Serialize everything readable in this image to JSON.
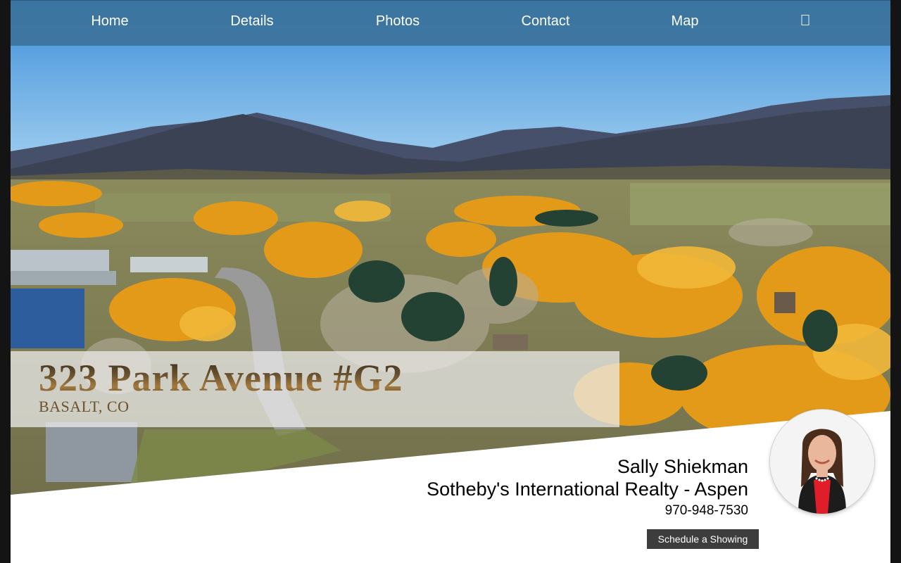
{
  "nav": {
    "items": [
      {
        "label": "Home"
      },
      {
        "label": "Details"
      },
      {
        "label": "Photos"
      },
      {
        "label": "Contact"
      },
      {
        "label": "Map"
      }
    ],
    "extra_icon": "square-icon"
  },
  "listing": {
    "address": "323 Park Avenue #G2",
    "city_state": "BASALT, CO"
  },
  "agent": {
    "name": "Sally Shiekman",
    "company": "Sotheby's International Realty - Aspen",
    "phone": "970-948-7530",
    "schedule_label": "Schedule a Showing"
  },
  "colors": {
    "nav_bg": "#3a7096",
    "button_bg": "#3d3d3d",
    "address_text": "#5b4628"
  }
}
